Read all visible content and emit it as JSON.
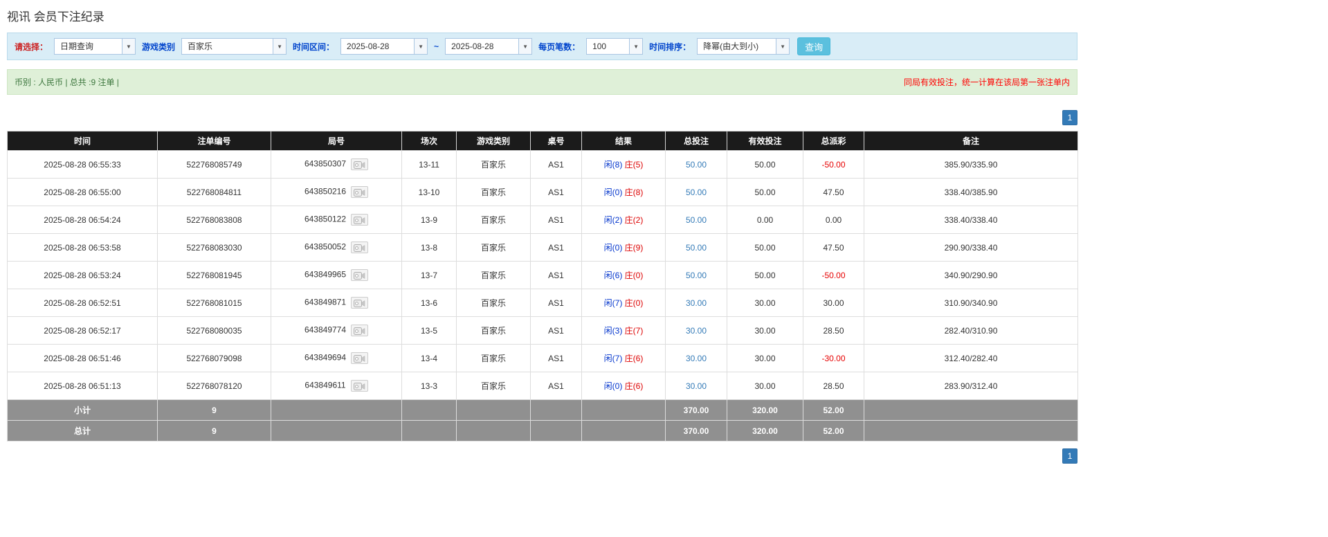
{
  "colors": {
    "accent_blue": "#337ab7",
    "header_bg": "#1b1b1b",
    "filter_bg": "#d9edf7",
    "filter_border": "#b8daeb",
    "info_bg": "#dff0d8",
    "info_border": "#cde6c2",
    "info_text": "#3c763d",
    "warn_red": "#ff0000",
    "label_red": "#cc2222",
    "label_blue": "#0044cc",
    "player_blue": "#0033cc",
    "banker_red": "#dd0000",
    "negative_red": "#e60000",
    "summary_bg": "#909090",
    "button_bg": "#5bc0de"
  },
  "page": {
    "title": "视讯 会员下注纪录"
  },
  "filters": {
    "select_label": "请选择：",
    "select_value": "日期查询",
    "game_label": "游戏类别",
    "game_value": "百家乐",
    "range_label": "时间区间：",
    "date_from": "2025-08-28",
    "range_separator": "~",
    "date_to": "2025-08-28",
    "per_page_label": "每页笔数：",
    "per_page_value": "100",
    "sort_label": "时间排序：",
    "sort_value": "降幂(由大到小)",
    "search_button": "查询"
  },
  "info_bar": {
    "left": "币别 : 人民币 | 总共 :9 注单 |",
    "right": "同局有效投注，统一计算在该局第一张注单内"
  },
  "pagination": {
    "page": "1"
  },
  "table": {
    "headers": [
      "时间",
      "注单编号",
      "局号",
      "场次",
      "游戏类别",
      "桌号",
      "结果",
      "总投注",
      "有效投注",
      "总派彩",
      "备注"
    ],
    "rows": [
      {
        "time": "2025-08-28 06:55:33",
        "bet_id": "522768085749",
        "round_id": "643850307",
        "session": "13-11",
        "game": "百家乐",
        "table": "AS1",
        "result_player": "闲(8)",
        "result_banker": "庄(5)",
        "total_bet": "50.00",
        "valid_bet": "50.00",
        "payout": "-50.00",
        "note": "385.90/335.90"
      },
      {
        "time": "2025-08-28 06:55:00",
        "bet_id": "522768084811",
        "round_id": "643850216",
        "session": "13-10",
        "game": "百家乐",
        "table": "AS1",
        "result_player": "闲(0)",
        "result_banker": "庄(8)",
        "total_bet": "50.00",
        "valid_bet": "50.00",
        "payout": "47.50",
        "note": "338.40/385.90"
      },
      {
        "time": "2025-08-28 06:54:24",
        "bet_id": "522768083808",
        "round_id": "643850122",
        "session": "13-9",
        "game": "百家乐",
        "table": "AS1",
        "result_player": "闲(2)",
        "result_banker": "庄(2)",
        "total_bet": "50.00",
        "valid_bet": "0.00",
        "payout": "0.00",
        "note": "338.40/338.40"
      },
      {
        "time": "2025-08-28 06:53:58",
        "bet_id": "522768083030",
        "round_id": "643850052",
        "session": "13-8",
        "game": "百家乐",
        "table": "AS1",
        "result_player": "闲(0)",
        "result_banker": "庄(9)",
        "total_bet": "50.00",
        "valid_bet": "50.00",
        "payout": "47.50",
        "note": "290.90/338.40"
      },
      {
        "time": "2025-08-28 06:53:24",
        "bet_id": "522768081945",
        "round_id": "643849965",
        "session": "13-7",
        "game": "百家乐",
        "table": "AS1",
        "result_player": "闲(6)",
        "result_banker": "庄(0)",
        "total_bet": "50.00",
        "valid_bet": "50.00",
        "payout": "-50.00",
        "note": "340.90/290.90"
      },
      {
        "time": "2025-08-28 06:52:51",
        "bet_id": "522768081015",
        "round_id": "643849871",
        "session": "13-6",
        "game": "百家乐",
        "table": "AS1",
        "result_player": "闲(7)",
        "result_banker": "庄(0)",
        "total_bet": "30.00",
        "valid_bet": "30.00",
        "payout": "30.00",
        "note": "310.90/340.90"
      },
      {
        "time": "2025-08-28 06:52:17",
        "bet_id": "522768080035",
        "round_id": "643849774",
        "session": "13-5",
        "game": "百家乐",
        "table": "AS1",
        "result_player": "闲(3)",
        "result_banker": "庄(7)",
        "total_bet": "30.00",
        "valid_bet": "30.00",
        "payout": "28.50",
        "note": "282.40/310.90"
      },
      {
        "time": "2025-08-28 06:51:46",
        "bet_id": "522768079098",
        "round_id": "643849694",
        "session": "13-4",
        "game": "百家乐",
        "table": "AS1",
        "result_player": "闲(7)",
        "result_banker": "庄(6)",
        "total_bet": "30.00",
        "valid_bet": "30.00",
        "payout": "-30.00",
        "note": "312.40/282.40"
      },
      {
        "time": "2025-08-28 06:51:13",
        "bet_id": "522768078120",
        "round_id": "643849611",
        "session": "13-3",
        "game": "百家乐",
        "table": "AS1",
        "result_player": "闲(0)",
        "result_banker": "庄(6)",
        "total_bet": "30.00",
        "valid_bet": "30.00",
        "payout": "28.50",
        "note": "283.90/312.40"
      }
    ],
    "subtotal": {
      "label": "小计",
      "count": "9",
      "total_bet": "370.00",
      "valid_bet": "320.00",
      "payout": "52.00"
    },
    "total": {
      "label": "总计",
      "count": "9",
      "total_bet": "370.00",
      "valid_bet": "320.00",
      "payout": "52.00"
    }
  }
}
